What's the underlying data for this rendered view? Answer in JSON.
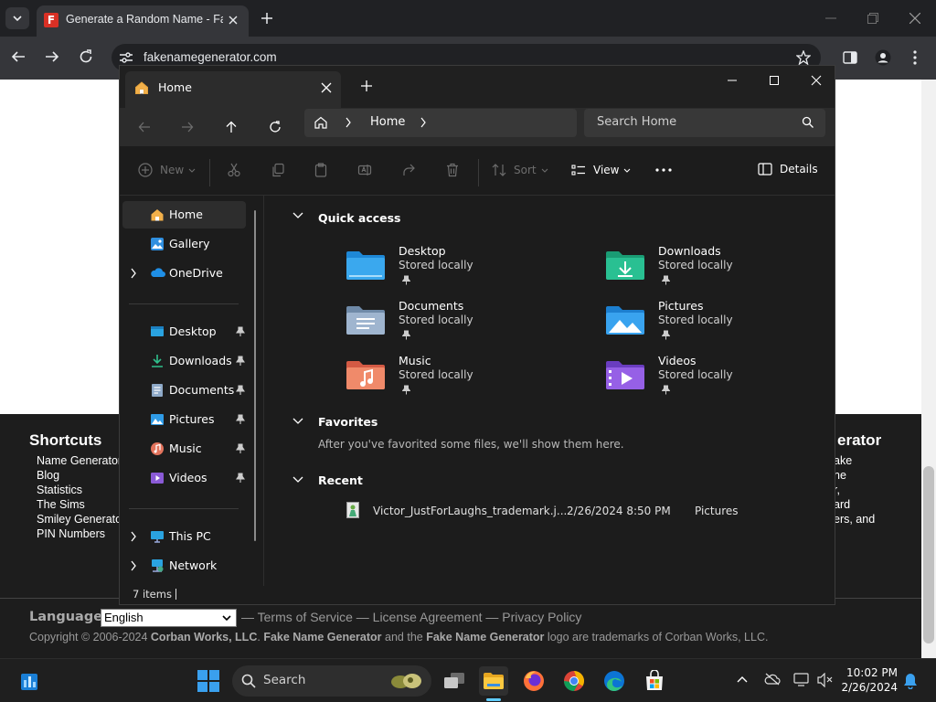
{
  "browser": {
    "tab_title": "Generate a Random Name - Fake Name Generator",
    "favicon_letter": "F",
    "url": "fakenamegenerator.com"
  },
  "page": {
    "shortcuts_title": "Shortcuts",
    "shortcuts": [
      "Name Generator",
      "Blog",
      "Statistics",
      "The Sims",
      "Smiley Generator",
      "PIN Numbers"
    ],
    "right_title_partial": "erator",
    "right_lines_partial": [
      "ake",
      "ne",
      "r,",
      "ard",
      "ers, and"
    ],
    "language_label": "Language:",
    "language_value": "English",
    "footer_links": "— Terms of Service — License Agreement — Privacy Policy",
    "copyright_prefix": "Copyright © 2006-2024 ",
    "copyright_company": "Corban Works, LLC",
    "copyright_mid1": ". ",
    "copyright_brand1": "Fake Name Generator",
    "copyright_mid2": " and the ",
    "copyright_brand2": "Fake Name Generator",
    "copyright_suffix": " logo are trademarks of Corban Works, LLC."
  },
  "explorer": {
    "tab_title": "Home",
    "address": "Home",
    "search_placeholder": "Search Home",
    "commands": {
      "new": "New",
      "sort": "Sort",
      "view": "View",
      "details": "Details"
    },
    "nav": {
      "home": "Home",
      "gallery": "Gallery",
      "onedrive": "OneDrive",
      "desktop": "Desktop",
      "downloads": "Downloads",
      "documents": "Documents",
      "pictures": "Pictures",
      "music": "Music",
      "videos": "Videos",
      "thispc": "This PC",
      "network": "Network"
    },
    "quick_access_title": "Quick access",
    "quick_access": [
      {
        "name": "Desktop",
        "sub": "Stored locally"
      },
      {
        "name": "Downloads",
        "sub": "Stored locally"
      },
      {
        "name": "Documents",
        "sub": "Stored locally"
      },
      {
        "name": "Pictures",
        "sub": "Stored locally"
      },
      {
        "name": "Music",
        "sub": "Stored locally"
      },
      {
        "name": "Videos",
        "sub": "Stored locally"
      }
    ],
    "favorites_title": "Favorites",
    "favorites_empty": "After you've favorited some files, we'll show them here.",
    "recent_title": "Recent",
    "recent": [
      {
        "name": "Victor_JustForLaughs_trademark.j...",
        "date": "2/26/2024 8:50 PM",
        "location": "Pictures"
      }
    ],
    "status": "7 items"
  },
  "taskbar": {
    "search_label": "Search",
    "time": "10:02 PM",
    "date": "2/26/2024"
  },
  "colors": {
    "accent": "#60cdff",
    "folder_yellow": "#f4c040",
    "explorer_bg": "#1c1c1c"
  }
}
